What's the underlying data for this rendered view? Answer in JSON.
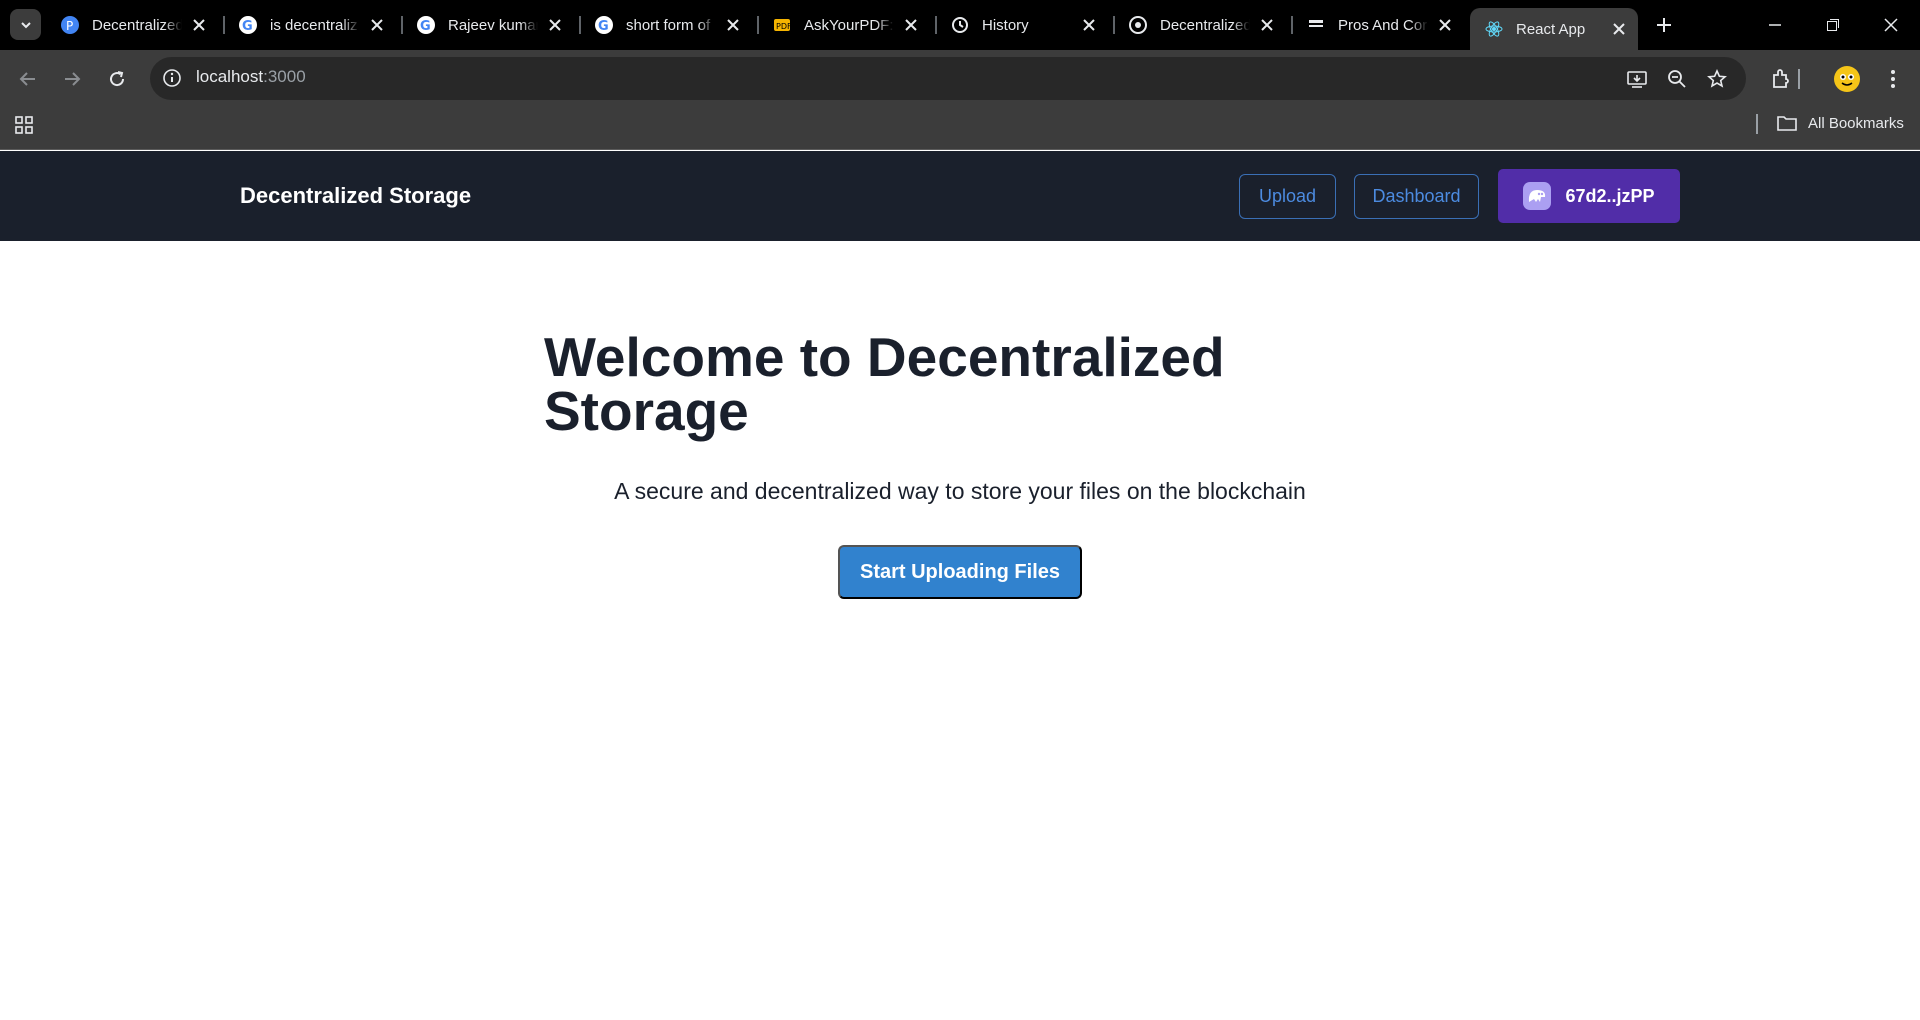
{
  "browser": {
    "tabs": [
      {
        "title": "Decentralized",
        "icon": "perplexity-favicon"
      },
      {
        "title": "is decentraliz",
        "icon": "google-favicon"
      },
      {
        "title": "Rajeev kumar",
        "icon": "google-favicon"
      },
      {
        "title": "short form of",
        "icon": "google-favicon"
      },
      {
        "title": "AskYourPDF:",
        "icon": "askyourpdf-favicon"
      },
      {
        "title": "History",
        "icon": "history-icon"
      },
      {
        "title": "Decentralized",
        "icon": "chatgpt-favicon"
      },
      {
        "title": "Pros And Cor",
        "icon": "document-favicon"
      },
      {
        "title": "React App",
        "icon": "react-favicon",
        "active": true
      }
    ],
    "url_host": "localhost",
    "url_port": ":3000",
    "bookmarks_label": "All Bookmarks"
  },
  "app": {
    "brand": "Decentralized Storage",
    "nav": {
      "upload_label": "Upload",
      "dashboard_label": "Dashboard",
      "wallet_label": "67d2..jzPP"
    },
    "hero": {
      "title": "Welcome to Decentralized Storage",
      "subtitle": "A secure and decentralized way to store your files on the blockchain",
      "cta_label": "Start Uploading Files"
    }
  },
  "colors": {
    "nav_bg": "#1a202c",
    "accent_blue": "#3182ce",
    "wallet_purple": "#512da8"
  }
}
